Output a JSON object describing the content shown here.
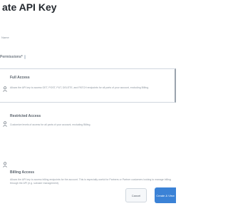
{
  "dialog": {
    "title": "ate API Key",
    "name_label": "Name",
    "permissions_label": "Permissions*"
  },
  "options": [
    {
      "title": "Full Access",
      "description": "Allows the API key to access GET, POST, PUT, DELETE, and PATCH endpoints for all parts of your account, excluding Billing.",
      "selected": true
    },
    {
      "title": "Restricted Access",
      "description": "Customize levels of access for all parts of your account, excluding Billing.",
      "selected": false
    },
    {
      "title": "Billing Access",
      "description": "Allows the API key to access billing endpoints for the account. This is especially useful for Partners or Partner customers looking to manage billing through the API (e.g. subuser management).",
      "selected": false
    }
  ],
  "buttons": {
    "cancel_label": "Cancel",
    "create_label": "Create & View"
  },
  "colors": {
    "accent": "#3b82d6",
    "border": "#d0d7de"
  }
}
